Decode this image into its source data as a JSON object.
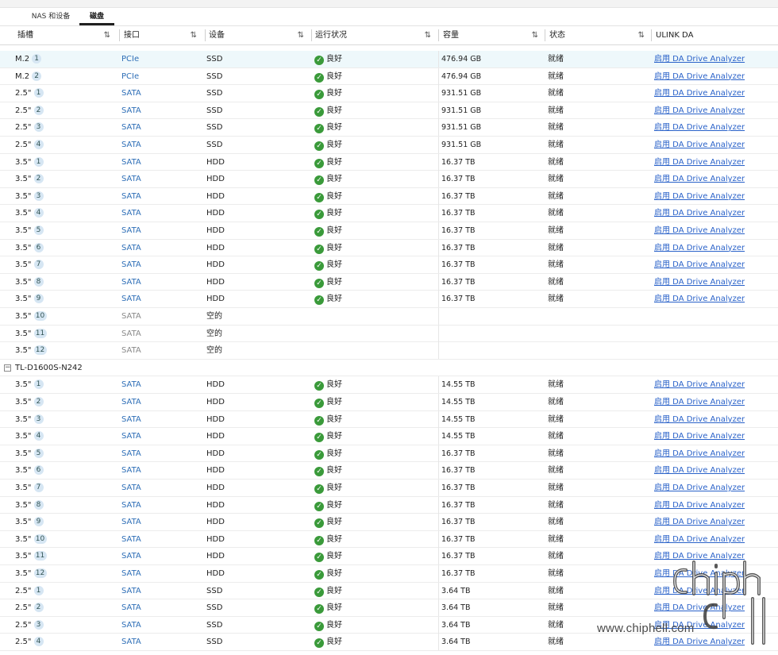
{
  "tabs": [
    {
      "label": "NAS 和设备",
      "active": false
    },
    {
      "label": "磁盘",
      "active": true
    }
  ],
  "columns": [
    {
      "label": "插槽",
      "sort_icon": "⇅"
    },
    {
      "label": "接口",
      "sort_icon": "⇅"
    },
    {
      "label": "设备",
      "sort_icon": "⇅"
    },
    {
      "label": "运行状况",
      "sort_icon": "⇅"
    },
    {
      "label": "容量",
      "sort_icon": "⇅"
    },
    {
      "label": "状态",
      "sort_icon": "⇅"
    },
    {
      "label": "ULINK DA",
      "sort_icon": ""
    }
  ],
  "link_label": "启用 DA Drive Analyzer",
  "ok_label": "良好",
  "ready_label": "就绪",
  "empty_label": "空的",
  "group1": {
    "rows": [
      {
        "slot": "M.2",
        "num": "1",
        "iface": "PCIe",
        "dev": "SSD",
        "health": "良好",
        "cap": "476.94 GB",
        "state": "就绪",
        "link": true
      },
      {
        "slot": "M.2",
        "num": "2",
        "iface": "PCIe",
        "dev": "SSD",
        "health": "良好",
        "cap": "476.94 GB",
        "state": "就绪",
        "link": true
      },
      {
        "slot": "2.5\"",
        "num": "1",
        "iface": "SATA",
        "dev": "SSD",
        "health": "良好",
        "cap": "931.51 GB",
        "state": "就绪",
        "link": true
      },
      {
        "slot": "2.5\"",
        "num": "2",
        "iface": "SATA",
        "dev": "SSD",
        "health": "良好",
        "cap": "931.51 GB",
        "state": "就绪",
        "link": true
      },
      {
        "slot": "2.5\"",
        "num": "3",
        "iface": "SATA",
        "dev": "SSD",
        "health": "良好",
        "cap": "931.51 GB",
        "state": "就绪",
        "link": true
      },
      {
        "slot": "2.5\"",
        "num": "4",
        "iface": "SATA",
        "dev": "SSD",
        "health": "良好",
        "cap": "931.51 GB",
        "state": "就绪",
        "link": true
      },
      {
        "slot": "3.5\"",
        "num": "1",
        "iface": "SATA",
        "dev": "HDD",
        "health": "良好",
        "cap": "16.37 TB",
        "state": "就绪",
        "link": true
      },
      {
        "slot": "3.5\"",
        "num": "2",
        "iface": "SATA",
        "dev": "HDD",
        "health": "良好",
        "cap": "16.37 TB",
        "state": "就绪",
        "link": true
      },
      {
        "slot": "3.5\"",
        "num": "3",
        "iface": "SATA",
        "dev": "HDD",
        "health": "良好",
        "cap": "16.37 TB",
        "state": "就绪",
        "link": true
      },
      {
        "slot": "3.5\"",
        "num": "4",
        "iface": "SATA",
        "dev": "HDD",
        "health": "良好",
        "cap": "16.37 TB",
        "state": "就绪",
        "link": true
      },
      {
        "slot": "3.5\"",
        "num": "5",
        "iface": "SATA",
        "dev": "HDD",
        "health": "良好",
        "cap": "16.37 TB",
        "state": "就绪",
        "link": true
      },
      {
        "slot": "3.5\"",
        "num": "6",
        "iface": "SATA",
        "dev": "HDD",
        "health": "良好",
        "cap": "16.37 TB",
        "state": "就绪",
        "link": true
      },
      {
        "slot": "3.5\"",
        "num": "7",
        "iface": "SATA",
        "dev": "HDD",
        "health": "良好",
        "cap": "16.37 TB",
        "state": "就绪",
        "link": true
      },
      {
        "slot": "3.5\"",
        "num": "8",
        "iface": "SATA",
        "dev": "HDD",
        "health": "良好",
        "cap": "16.37 TB",
        "state": "就绪",
        "link": true
      },
      {
        "slot": "3.5\"",
        "num": "9",
        "iface": "SATA",
        "dev": "HDD",
        "health": "良好",
        "cap": "16.37 TB",
        "state": "就绪",
        "link": true
      },
      {
        "slot": "3.5\"",
        "num": "10",
        "iface": "SATA",
        "dev": "空的",
        "health": "",
        "cap": "",
        "state": "",
        "link": false
      },
      {
        "slot": "3.5\"",
        "num": "11",
        "iface": "SATA",
        "dev": "空的",
        "health": "",
        "cap": "",
        "state": "",
        "link": false
      },
      {
        "slot": "3.5\"",
        "num": "12",
        "iface": "SATA",
        "dev": "空的",
        "health": "",
        "cap": "",
        "state": "",
        "link": false
      }
    ]
  },
  "group2": {
    "label": "TL-D1600S-N242",
    "toggle": "−",
    "rows": [
      {
        "slot": "3.5\"",
        "num": "1",
        "iface": "SATA",
        "dev": "HDD",
        "health": "良好",
        "cap": "14.55 TB",
        "state": "就绪",
        "link": true
      },
      {
        "slot": "3.5\"",
        "num": "2",
        "iface": "SATA",
        "dev": "HDD",
        "health": "良好",
        "cap": "14.55 TB",
        "state": "就绪",
        "link": true
      },
      {
        "slot": "3.5\"",
        "num": "3",
        "iface": "SATA",
        "dev": "HDD",
        "health": "良好",
        "cap": "14.55 TB",
        "state": "就绪",
        "link": true
      },
      {
        "slot": "3.5\"",
        "num": "4",
        "iface": "SATA",
        "dev": "HDD",
        "health": "良好",
        "cap": "14.55 TB",
        "state": "就绪",
        "link": true
      },
      {
        "slot": "3.5\"",
        "num": "5",
        "iface": "SATA",
        "dev": "HDD",
        "health": "良好",
        "cap": "16.37 TB",
        "state": "就绪",
        "link": true
      },
      {
        "slot": "3.5\"",
        "num": "6",
        "iface": "SATA",
        "dev": "HDD",
        "health": "良好",
        "cap": "16.37 TB",
        "state": "就绪",
        "link": true
      },
      {
        "slot": "3.5\"",
        "num": "7",
        "iface": "SATA",
        "dev": "HDD",
        "health": "良好",
        "cap": "16.37 TB",
        "state": "就绪",
        "link": true
      },
      {
        "slot": "3.5\"",
        "num": "8",
        "iface": "SATA",
        "dev": "HDD",
        "health": "良好",
        "cap": "16.37 TB",
        "state": "就绪",
        "link": true
      },
      {
        "slot": "3.5\"",
        "num": "9",
        "iface": "SATA",
        "dev": "HDD",
        "health": "良好",
        "cap": "16.37 TB",
        "state": "就绪",
        "link": true
      },
      {
        "slot": "3.5\"",
        "num": "10",
        "iface": "SATA",
        "dev": "HDD",
        "health": "良好",
        "cap": "16.37 TB",
        "state": "就绪",
        "link": true
      },
      {
        "slot": "3.5\"",
        "num": "11",
        "iface": "SATA",
        "dev": "HDD",
        "health": "良好",
        "cap": "16.37 TB",
        "state": "就绪",
        "link": true
      },
      {
        "slot": "3.5\"",
        "num": "12",
        "iface": "SATA",
        "dev": "HDD",
        "health": "良好",
        "cap": "16.37 TB",
        "state": "就绪",
        "link": true
      },
      {
        "slot": "2.5\"",
        "num": "1",
        "iface": "SATA",
        "dev": "SSD",
        "health": "良好",
        "cap": "3.64 TB",
        "state": "就绪",
        "link": true
      },
      {
        "slot": "2.5\"",
        "num": "2",
        "iface": "SATA",
        "dev": "SSD",
        "health": "良好",
        "cap": "3.64 TB",
        "state": "就绪",
        "link": true
      },
      {
        "slot": "2.5\"",
        "num": "3",
        "iface": "SATA",
        "dev": "SSD",
        "health": "良好",
        "cap": "3.64 TB",
        "state": "就绪",
        "link": true
      },
      {
        "slot": "2.5\"",
        "num": "4",
        "iface": "SATA",
        "dev": "SSD",
        "health": "良好",
        "cap": "3.64 TB",
        "state": "就绪",
        "link": true
      }
    ]
  },
  "watermark": {
    "text": "www.chiphell.com",
    "logo": "chip hell"
  },
  "colors": {
    "link": "#2a62c9",
    "ok": "#3a9a3a",
    "highlight_row": "#eef8fb",
    "iface": "#2f6fb7"
  }
}
